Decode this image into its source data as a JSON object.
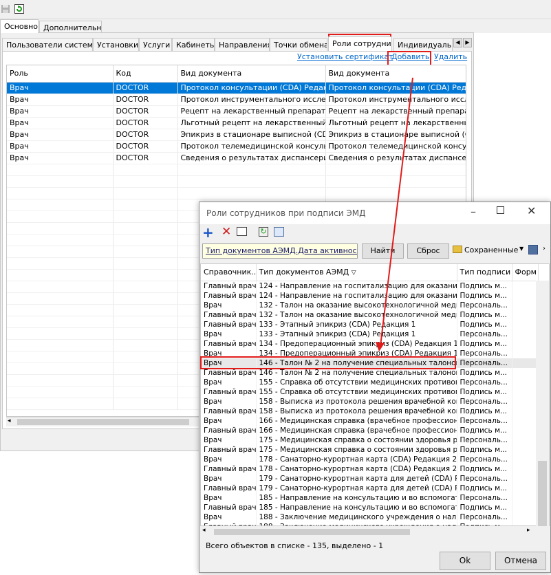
{
  "toolbar_top": {
    "icons": [
      "save-icon",
      "refresh-icon"
    ]
  },
  "top_tabs": [
    "Основное",
    "Дополнительно"
  ],
  "sub_tabs": [
    "Пользователи системы",
    "Установки",
    "Услуги",
    "Кабинеты",
    "Направления",
    "Точки обмена",
    "Роли сотрудника",
    "Индивидуальн"
  ],
  "actions": {
    "set_cert": "Установить сертификат",
    "add": "Добавить",
    "delete": "Удалить"
  },
  "main_grid": {
    "columns": [
      "Роль",
      "Код",
      "Вид документа",
      "Вид документа"
    ],
    "rows": [
      [
        "Врач",
        "DOCTOR",
        "Протокол консультации (CDA) Редакция...",
        "Протокол консультации (CDA) Редакция..."
      ],
      [
        "Врач",
        "DOCTOR",
        "Протокол инструментального исследо...",
        "Протокол инструментального исследо..."
      ],
      [
        "Врач",
        "DOCTOR",
        "Рецепт на лекарственный препарат (С...",
        "Рецепт на лекарственный препарат (С..."
      ],
      [
        "Врач",
        "DOCTOR",
        "Льготный рецепт на лекарственный п...",
        "Льготный рецепт на лекарственный п..."
      ],
      [
        "Врач",
        "DOCTOR",
        "Эпикриз в стационаре выписной (CDA)",
        "Эпикриз в стационаре выписной (CDA)"
      ],
      [
        "Врач",
        "DOCTOR",
        "Протокол телемедицинской консульт...",
        "Протокол телемедицинской консульт..."
      ],
      [
        "Врач",
        "DOCTOR",
        "Сведения о результатах диспансериз...",
        "Сведения о результатах диспансериз..."
      ]
    ]
  },
  "dialog": {
    "title": "Роли сотрудников при подписи ЭМД",
    "filter_chip": "Тип документов АЭМД.Дата активност...",
    "find_label": "Найти",
    "reset_label": "Сброс",
    "saved_label": "Сохраненные",
    "columns": [
      "Справочник...",
      "Тип документов АЭМД",
      "Тип подписи",
      "Форм"
    ],
    "rows": [
      [
        "Главный врач",
        "124 - Направление на госпитализацию для оказания...",
        "Подпись м..."
      ],
      [
        "Главный врач",
        "124 - Направление на госпитализацию для оказания...",
        "Подпись м..."
      ],
      [
        "Врач",
        "132 - Талон на оказание высокотехнологичной меди...",
        "Персональ..."
      ],
      [
        "Главный врач",
        "132 - Талон на оказание высокотехнологичной меди...",
        "Подпись м..."
      ],
      [
        "Главный врач",
        "133 - Этапный эпикриз (CDA) Редакция 1",
        "Подпись м..."
      ],
      [
        "Врач",
        "133 - Этапный эпикриз (CDA) Редакция 1",
        "Персональ..."
      ],
      [
        "Главный врач",
        "134 - Предоперационный эпикриз (CDA) Редакция 1",
        "Подпись м..."
      ],
      [
        "Врач",
        "134 - Предоперационный эпикриз (CDA) Редакция 1",
        "Персональ..."
      ],
      [
        "Врач",
        "146 - Талон № 2 на получение специальных талонов ...",
        "Персональ..."
      ],
      [
        "Главный врач",
        "146 - Талон № 2 на получение специальных талонов ...",
        "Подпись м..."
      ],
      [
        "Врач",
        "155 - Справка об отсутствии медицинских противопо...",
        "Персональ..."
      ],
      [
        "Главный врач",
        "155 - Справка об отсутствии медицинских противопо...",
        "Подпись м..."
      ],
      [
        "Врач",
        "158 - Выписка из протокола решения врачебной ком...",
        "Персональ..."
      ],
      [
        "Главный врач",
        "158 - Выписка из протокола решения врачебной ком...",
        "Подпись м..."
      ],
      [
        "Врач",
        "166 - Медицинская справка (врачебное профессион...",
        "Персональ..."
      ],
      [
        "Главный врач",
        "166 - Медицинская справка (врачебное профессион...",
        "Подпись м..."
      ],
      [
        "Врач",
        "175 - Медицинская справка о состоянии здоровья р...",
        "Персональ..."
      ],
      [
        "Главный врач",
        "175 - Медицинская справка о состоянии здоровья р...",
        "Подпись м..."
      ],
      [
        "Врач",
        "178 - Санаторно-курортная карта (CDA) Редакция 2",
        "Персональ..."
      ],
      [
        "Главный врач",
        "178 - Санаторно-курортная карта (CDA) Редакция 2",
        "Подпись м..."
      ],
      [
        "Врач",
        "179 - Санаторно-курортная карта для детей (CDA) Ре...",
        "Персональ..."
      ],
      [
        "Главный врач",
        "179 - Санаторно-курортная карта для детей (CDA) Ре...",
        "Подпись м..."
      ],
      [
        "Врач",
        "185 - Направление на консультацию и во вспомогат...",
        "Персональ..."
      ],
      [
        "Главный врач",
        "185 - Направление на консультацию и во вспомогат...",
        "Подпись м..."
      ],
      [
        "Врач",
        "188 - Заключение медицинского учреждения о налич...",
        "Персональ..."
      ],
      [
        "Главный врач",
        "188 - Заключение медицинского учреждения о налич...",
        "Подпись м..."
      ]
    ],
    "status": "Всего объектов в списке - 135, выделено - 1",
    "ok_label": "Ok",
    "cancel_label": "Отмена"
  },
  "colors": {
    "selection": "#0078d7",
    "annotation": "#e21b1b",
    "link": "#0066cc",
    "filter_bg": "#ffffe1"
  }
}
